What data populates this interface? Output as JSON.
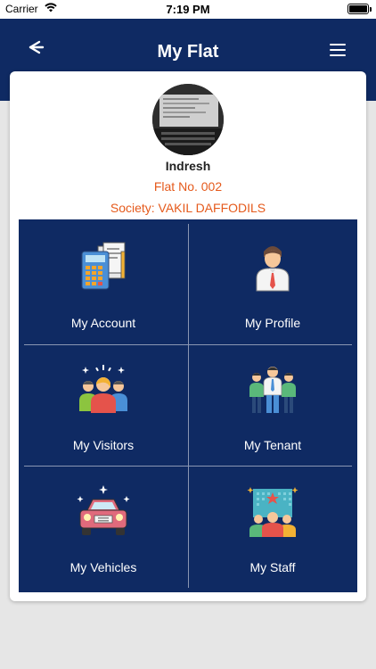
{
  "status_bar": {
    "carrier": "Carrier",
    "time": "7:19 PM"
  },
  "header": {
    "title": "My Flat",
    "back_icon": "arrow-left-icon",
    "menu_icon": "hamburger-menu-icon"
  },
  "profile": {
    "name": "Indresh",
    "flat": "Flat No. 002",
    "society": "Society: VAKIL DAFFODILS"
  },
  "tiles": [
    {
      "label": "My Account",
      "icon": "accounting-icon"
    },
    {
      "label": "My Profile",
      "icon": "person-icon"
    },
    {
      "label": "My Visitors",
      "icon": "visitors-group-icon"
    },
    {
      "label": "My Tenant",
      "icon": "tenant-group-icon"
    },
    {
      "label": "My Vehicles",
      "icon": "car-icon"
    },
    {
      "label": "My Staff",
      "icon": "staff-group-icon"
    }
  ],
  "colors": {
    "brand": "#0f2a63",
    "accent": "#e55a1c"
  }
}
